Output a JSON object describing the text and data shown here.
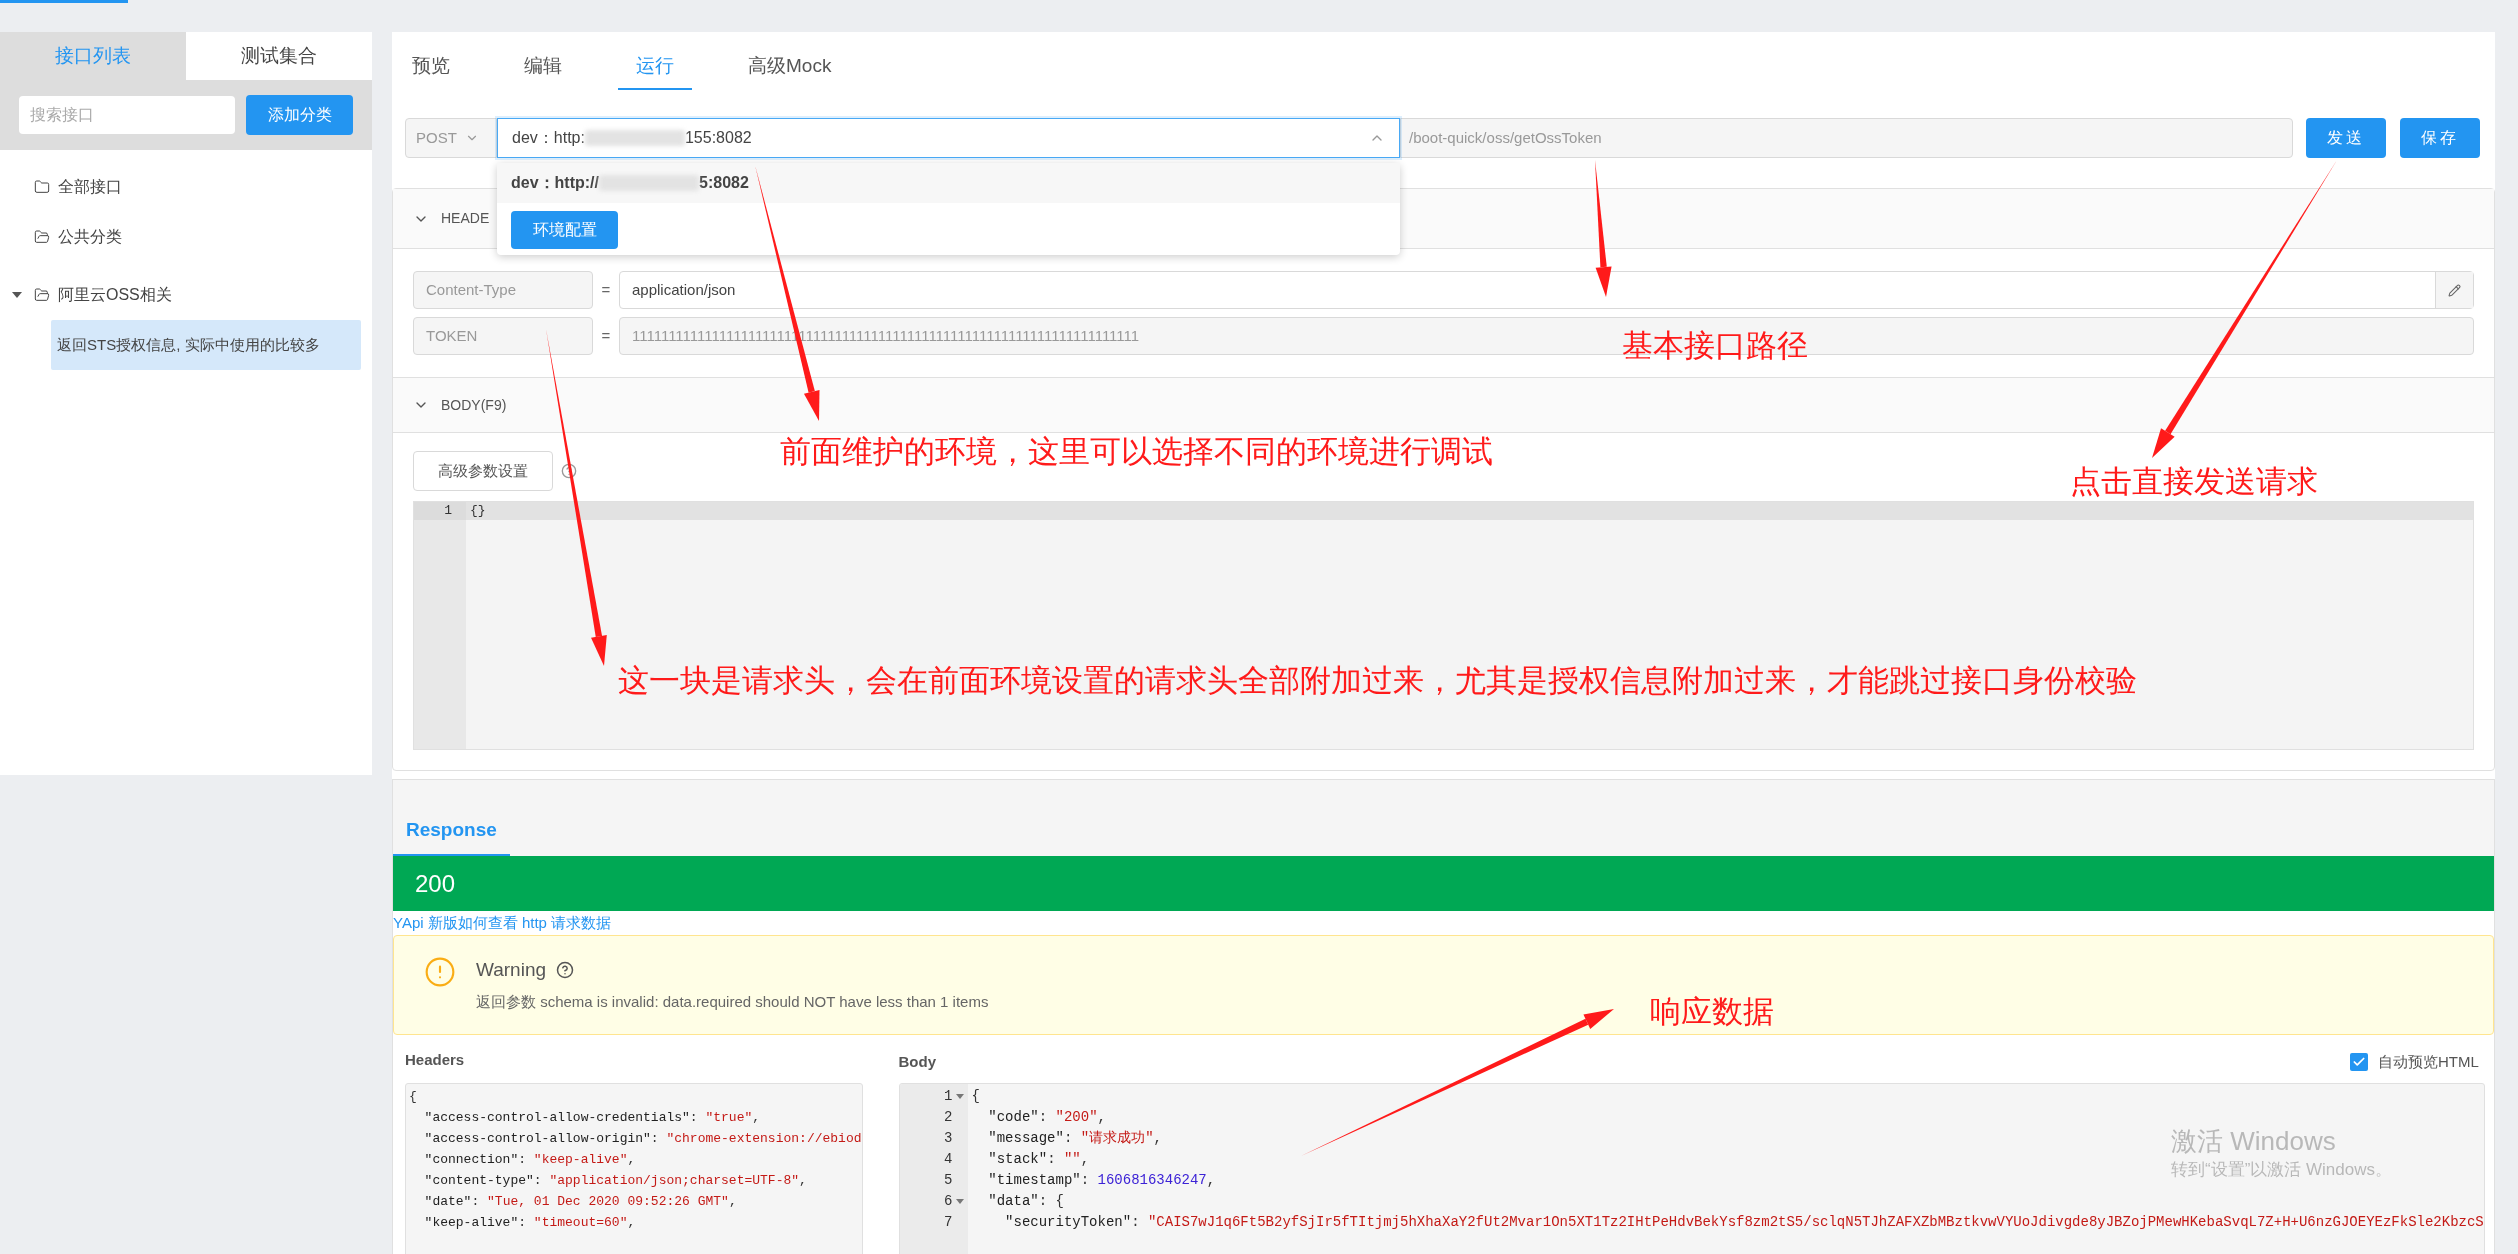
{
  "sidebar": {
    "tabs": [
      {
        "label": "接口列表",
        "selected": true
      },
      {
        "label": "测试集合",
        "selected": false
      }
    ],
    "search": {
      "placeholder": "搜索接口"
    },
    "add_button": "添加分类",
    "tree": [
      {
        "label": "全部接口",
        "expanded": false,
        "selected": false
      },
      {
        "label": "公共分类",
        "expanded": false,
        "selected": false
      },
      {
        "label": "阿里云OSS相关",
        "expanded": true,
        "selected": false,
        "children": [
          {
            "label": "返回STS授权信息, 实际中使用的比较多",
            "selected": true
          }
        ]
      }
    ]
  },
  "tabs": [
    {
      "label": "预览",
      "selected": false
    },
    {
      "label": "编辑",
      "selected": false
    },
    {
      "label": "运行",
      "selected": true
    },
    {
      "label": "高级Mock",
      "selected": false
    }
  ],
  "request": {
    "method": "POST",
    "env": {
      "prefix": "dev：http:",
      "suffix": "155:8082",
      "open": true
    },
    "path": "/boot-quick/oss/getOssToken",
    "buttons": [
      "发送",
      "保存"
    ]
  },
  "env_dropdown": {
    "items": [
      {
        "prefix": "dev：http://",
        "suffix": "5:8082",
        "selected": true
      }
    ],
    "config_button": "环境配置"
  },
  "headers_section": {
    "title": "HEADE",
    "expanded": true,
    "rows": [
      {
        "key": "Content-Type",
        "operator": "=",
        "value": "application/json",
        "disabled": false
      },
      {
        "key": "TOKEN",
        "operator": "=",
        "value": "1111111111111111111111111111111111111111111111111111111111111111111111",
        "disabled": true
      }
    ]
  },
  "body_section": {
    "title": "BODY(F9)",
    "expanded": true,
    "advanced_button": "高级参数设置",
    "editor": [
      {
        "number": "1",
        "text": "{}"
      }
    ]
  },
  "response": {
    "tab": "Response",
    "status": "200",
    "help_link": "YApi 新版如何查看 http 请求数据",
    "warning": {
      "title": "Warning",
      "message": "返回参数 schema is invalid: data.required should NOT have less than 1 items"
    },
    "headers": {
      "title": "Headers",
      "lines": [
        [
          {
            "text": "{",
            "kind": "plain"
          }
        ],
        [
          {
            "text": "  \"access-control-allow-credentials\"",
            "kind": "key"
          },
          {
            "text": ": ",
            "kind": "plain"
          },
          {
            "text": "\"true\"",
            "kind": "string"
          },
          {
            "text": ",",
            "kind": "plain"
          }
        ],
        [
          {
            "text": "  \"access-control-allow-origin\"",
            "kind": "key"
          },
          {
            "text": ": ",
            "kind": "plain"
          },
          {
            "text": "\"chrome-extension://ebiod",
            "kind": "string"
          }
        ],
        [
          {
            "text": "  \"connection\"",
            "kind": "key"
          },
          {
            "text": ": ",
            "kind": "plain"
          },
          {
            "text": "\"keep-alive\"",
            "kind": "string"
          },
          {
            "text": ",",
            "kind": "plain"
          }
        ],
        [
          {
            "text": "  \"content-type\"",
            "kind": "key"
          },
          {
            "text": ": ",
            "kind": "plain"
          },
          {
            "text": "\"application/json;charset=UTF-8\"",
            "kind": "string"
          },
          {
            "text": ",",
            "kind": "plain"
          }
        ],
        [
          {
            "text": "  \"date\"",
            "kind": "key"
          },
          {
            "text": ": ",
            "kind": "plain"
          },
          {
            "text": "\"Tue, 01 Dec 2020 09:52:26 GMT\"",
            "kind": "string"
          },
          {
            "text": ",",
            "kind": "plain"
          }
        ],
        [
          {
            "text": "  \"keep-alive\"",
            "kind": "key"
          },
          {
            "text": ": ",
            "kind": "plain"
          },
          {
            "text": "\"timeout=60\"",
            "kind": "string"
          },
          {
            "text": ",",
            "kind": "plain"
          }
        ]
      ]
    },
    "body": {
      "title": "Body",
      "auto_preview": {
        "label": "自动预览HTML",
        "checked": true
      },
      "lines": [
        {
          "number": "1",
          "fold": true,
          "segments": [
            {
              "text": "{",
              "kind": "plain"
            }
          ]
        },
        {
          "number": "2",
          "fold": false,
          "segments": [
            {
              "text": "  \"code\"",
              "kind": "key"
            },
            {
              "text": ": ",
              "kind": "plain"
            },
            {
              "text": "\"200\"",
              "kind": "string"
            },
            {
              "text": ",",
              "kind": "plain"
            }
          ]
        },
        {
          "number": "3",
          "fold": false,
          "segments": [
            {
              "text": "  \"message\"",
              "kind": "key"
            },
            {
              "text": ": ",
              "kind": "plain"
            },
            {
              "text": "\"请求成功\"",
              "kind": "string"
            },
            {
              "text": ",",
              "kind": "plain"
            }
          ]
        },
        {
          "number": "4",
          "fold": false,
          "segments": [
            {
              "text": "  \"stack\"",
              "kind": "key"
            },
            {
              "text": ": ",
              "kind": "plain"
            },
            {
              "text": "\"\"",
              "kind": "string"
            },
            {
              "text": ",",
              "kind": "plain"
            }
          ]
        },
        {
          "number": "5",
          "fold": false,
          "segments": [
            {
              "text": "  \"timestamp\"",
              "kind": "key"
            },
            {
              "text": ": ",
              "kind": "plain"
            },
            {
              "text": "1606816346247",
              "kind": "number"
            },
            {
              "text": ",",
              "kind": "plain"
            }
          ]
        },
        {
          "number": "6",
          "fold": true,
          "segments": [
            {
              "text": "  \"data\"",
              "kind": "key"
            },
            {
              "text": ": {",
              "kind": "plain"
            }
          ]
        },
        {
          "number": "7",
          "fold": false,
          "segments": [
            {
              "text": "    \"securityToken\"",
              "kind": "key"
            },
            {
              "text": ": ",
              "kind": "plain"
            },
            {
              "text": "\"CAIS7wJ1q6Ft5B2yfSjIr5fTItjmj5hXhaXaY2fUt2Mvar1On5XT1Tz2IHtPeHdvBekYsf8zm2tS5/sclqN5TJhZAFXZbMBztkvwVYUoJdivgde8yJBZojPMewHKebaSvqL7Z+H+U6nzGJOEYEzFkSle2KbzcS",
              "kind": "string"
            }
          ]
        }
      ]
    }
  },
  "os_notice": {
    "title": "激活 Windows",
    "subtitle": "转到“设置”以激活 Windows。"
  },
  "annotations": [
    {
      "text": "基本接口路径"
    },
    {
      "text": "前面维护的环境，这里可以选择不同的环境进行调试"
    },
    {
      "text": "点击直接发送请求"
    },
    {
      "text": "这一块是请求头，会在前面环境设置的请求头全部附加过来，尤其是授权信息附加过来，才能跳过接口身份校验"
    },
    {
      "text": "响应数据"
    }
  ]
}
